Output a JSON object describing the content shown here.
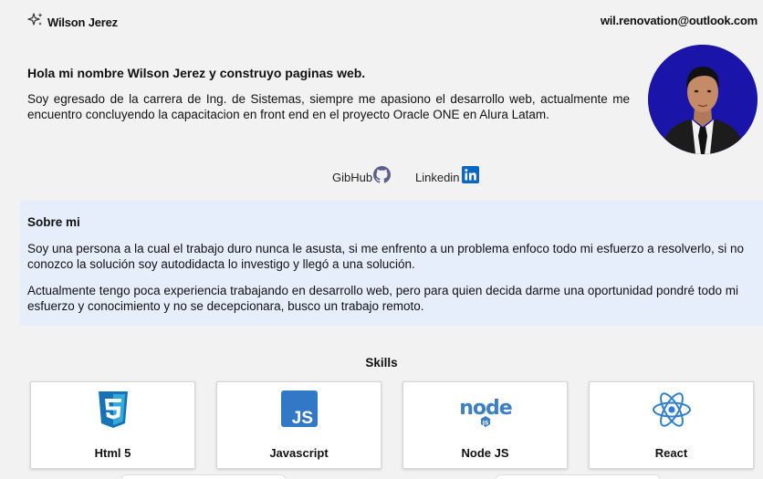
{
  "header": {
    "brand_name": "Wilson Jerez",
    "email": "wil.renovation@outlook.com"
  },
  "intro": {
    "title": "Hola mi nombre Wilson Jerez y construyo paginas web.",
    "body": "Soy egresado de la carrera de Ing. de Sistemas, siempre me apasiono el desarrollo web, actualmente me encuentro concluyendo la capacitacion en front end en el proyecto Oracle ONE en Alura Latam."
  },
  "social": {
    "github_label": "GibHub",
    "linkedin_label": "Linkedin"
  },
  "about": {
    "title": "Sobre mi",
    "paragraph1": "Soy una persona a la cual el trabajo duro nunca le asusta, si me enfrento a un problema enfoco todo mi esfuerzo a resolverlo, si no conozco la solución soy autodidacta lo investigo y llegó a una solución.",
    "paragraph2": "Actualmente tengo poca experiencia trabajando en desarrollo web, pero para quien decida darme una oportunidad pondré todo mi esfuerzo y conocimiento y no se decepcionara, busco un trabajo remoto."
  },
  "skills": {
    "title": "Skills",
    "items": [
      {
        "label": "Html 5",
        "icon": "html5-icon",
        "color": "#1572b6"
      },
      {
        "label": "Javascript",
        "icon": "javascript-icon",
        "color": "#3178c6"
      },
      {
        "label": "Node JS",
        "icon": "nodejs-icon",
        "color": "#3c7fc4"
      },
      {
        "label": "React",
        "icon": "react-icon",
        "color": "#2f7fd0"
      }
    ]
  },
  "colors": {
    "about_bg": "#e6eefb",
    "avatar_bg": "#1b14a8",
    "page_bg": "#f2f2f2"
  }
}
